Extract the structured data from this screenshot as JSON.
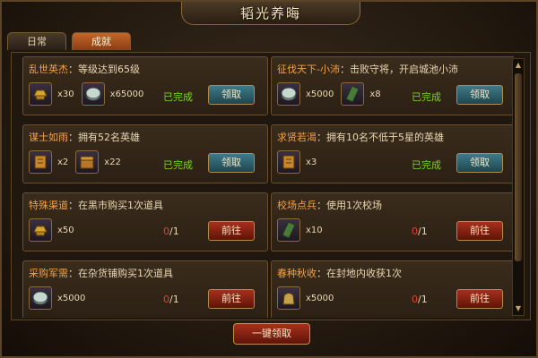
{
  "window": {
    "title": "韬光养晦"
  },
  "tabs": [
    {
      "label": "日常",
      "active": false
    },
    {
      "label": "成就",
      "active": true
    }
  ],
  "achievements": [
    {
      "name": "乱世英杰",
      "desc": "：等级达到65级",
      "rewards": [
        {
          "icon": "gold-ingot-icon",
          "qty": "x30"
        },
        {
          "icon": "silver-coin-icon",
          "qty": "x65000"
        }
      ],
      "status": "已完成",
      "action": "领取"
    },
    {
      "name": "征伐天下-小沛",
      "desc": "：击败守将，开启城池小沛",
      "rewards": [
        {
          "icon": "silver-coin-icon",
          "qty": "x5000"
        },
        {
          "icon": "scroll-icon",
          "qty": "x8"
        }
      ],
      "status": "已完成",
      "action": "领取"
    },
    {
      "name": "谋士如雨",
      "desc": "：拥有52名英雄",
      "rewards": [
        {
          "icon": "book-icon",
          "qty": "x2"
        },
        {
          "icon": "treasure-icon",
          "qty": "x22"
        }
      ],
      "status": "已完成",
      "action": "领取"
    },
    {
      "name": "求贤若渴",
      "desc": "：拥有10名不低于5星的英雄",
      "rewards": [
        {
          "icon": "book-icon",
          "qty": "x3"
        }
      ],
      "status": "已完成",
      "action": "领取"
    },
    {
      "name": "特殊渠道",
      "desc": "：在黑市购买1次道具",
      "rewards": [
        {
          "icon": "gold-ingot-icon",
          "qty": "x50"
        }
      ],
      "progress_current": "0",
      "progress_total": "/1",
      "action": "前往"
    },
    {
      "name": "校场点兵",
      "desc": "：使用1次校场",
      "rewards": [
        {
          "icon": "scroll-icon",
          "qty": "x10"
        }
      ],
      "progress_current": "0",
      "progress_total": "/1",
      "action": "前往"
    },
    {
      "name": "采购军需",
      "desc": "：在杂货铺购买1次道具",
      "rewards": [
        {
          "icon": "silver-coin-icon",
          "qty": "x5000"
        }
      ],
      "progress_current": "0",
      "progress_total": "/1",
      "action": "前往"
    },
    {
      "name": "春种秋收",
      "desc": "：在封地内收获1次",
      "rewards": [
        {
          "icon": "grain-sack-icon",
          "qty": "x5000"
        }
      ],
      "progress_current": "0",
      "progress_total": "/1",
      "action": "前往"
    }
  ],
  "footer": {
    "claim_all": "一键领取"
  },
  "colors": {
    "done": "#7ed320",
    "progress_red": "#e04030",
    "name_orange": "#f0a24a"
  }
}
